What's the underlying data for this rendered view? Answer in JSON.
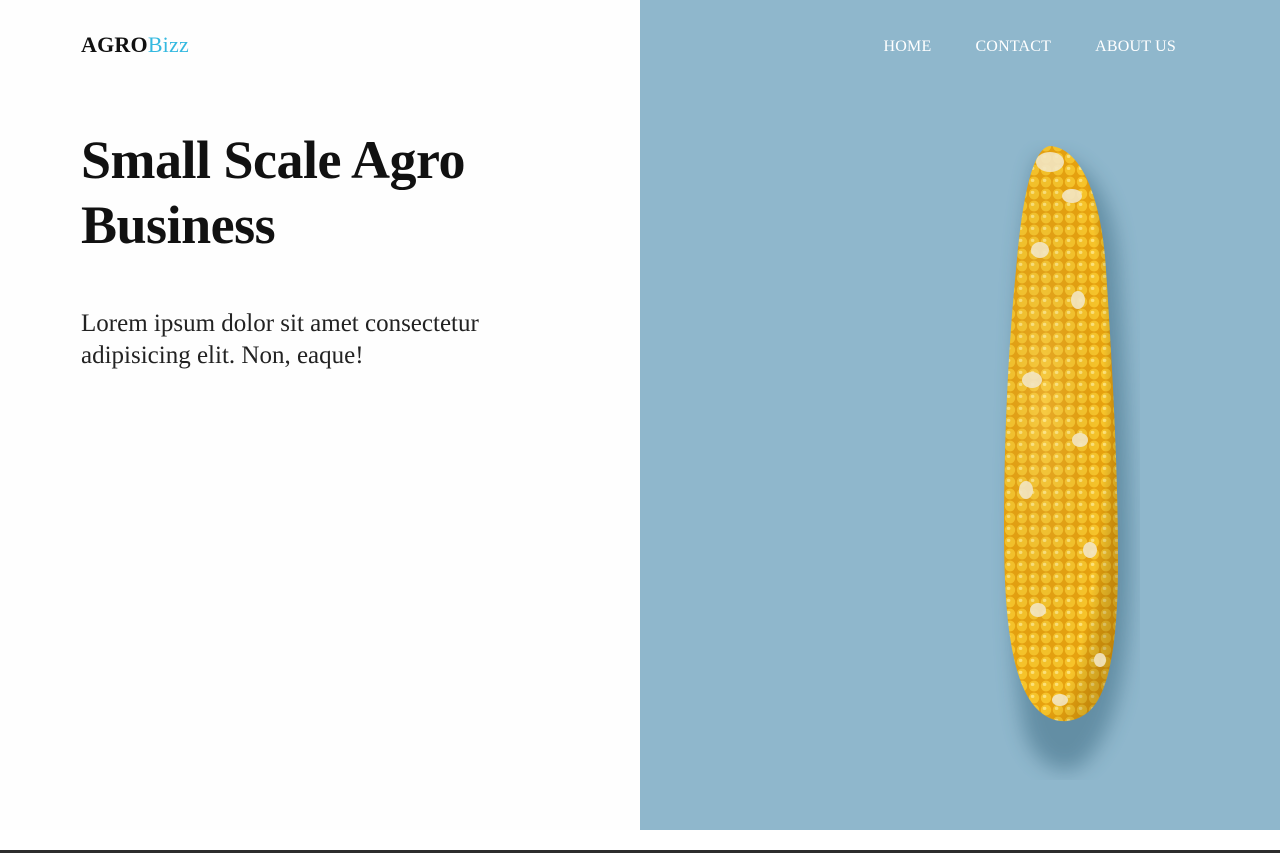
{
  "brand": {
    "part1": "AGRO",
    "part2": "Bizz",
    "accent_color": "#35b9e0"
  },
  "nav": {
    "items": [
      "HOME",
      "CONTACT",
      "ABOUT US"
    ]
  },
  "hero": {
    "title": "Small Scale Agro Business",
    "subtitle": "Lorem ipsum dolor sit amet consectetur adipisicing elit. Non, eaque!"
  },
  "colors": {
    "panel_background": "#8fb7cc",
    "corn": "#f2b51d"
  },
  "image": {
    "icon": "corn-cob-icon"
  }
}
